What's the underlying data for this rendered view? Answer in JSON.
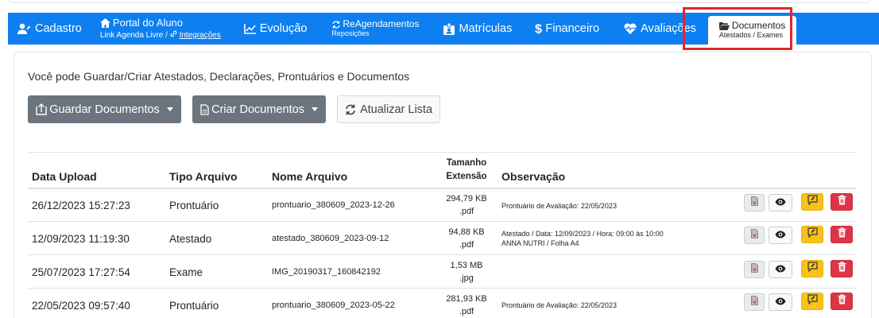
{
  "nav": {
    "cadastro": "Cadastro",
    "portal_title": "Portal do Aluno",
    "portal_sub_a": "Link Agenda Livre / ",
    "portal_sub_b": "Integrações",
    "evolucao": "Evolução",
    "reag_title": "ReAgendamentos",
    "reag_sub": "Reposições",
    "matriculas": "Matrículas",
    "financeiro": "Financeiro",
    "avaliacoes": "Avaliações",
    "documentos_title": "Documentos",
    "documentos_sub": "Atestados / Exames"
  },
  "colors": {
    "nav_bg": "#0d7ff0",
    "highlight": "#e3262a",
    "btn_dark": "#6c757d",
    "btn_yellow": "#f7c21b",
    "btn_red": "#dc3545"
  },
  "main": {
    "info_text": "Você pode Guardar/Criar Atestados, Declarações, Prontuários e Documentos",
    "guardar_label": "Guardar Documentos",
    "criar_label": "Criar Documentos",
    "atualizar_label": "Atualizar Lista"
  },
  "table": {
    "headers": {
      "data_upload": "Data Upload",
      "tipo_arquivo": "Tipo Arquivo",
      "nome_arquivo": "Nome Arquivo",
      "tamanho": "Tamanho",
      "extensao": "Extensão",
      "observacao": "Observação"
    },
    "rows": [
      {
        "data": "26/12/2023 15:27:23",
        "tipo": "Prontuário",
        "nome": "prontuario_380609_2023-12-26",
        "tamanho": "294,79 KB",
        "ext": ".pdf",
        "obs1": "Prontuário de Avaliação: 22/05/2023",
        "obs2": ""
      },
      {
        "data": "12/09/2023 11:19:30",
        "tipo": "Atestado",
        "nome": "atestado_380609_2023-09-12",
        "tamanho": "94,88 KB",
        "ext": ".pdf",
        "obs1": "Atestado / Data: 12/09/2023 / Hora: 09:00 às 10:00",
        "obs2": "ANNA NUTRI / Folha A4"
      },
      {
        "data": "25/07/2023 17:27:54",
        "tipo": "Exame",
        "nome": "IMG_20190317_160842192",
        "tamanho": "1,53 MB",
        "ext": ".jpg",
        "obs1": "",
        "obs2": ""
      },
      {
        "data": "22/05/2023 09:57:40",
        "tipo": "Prontuário",
        "nome": "prontuario_380609_2023-05-22",
        "tamanho": "281,93 KB",
        "ext": ".pdf",
        "obs1": "Prontuário de Avaliação: 22/05/2023",
        "obs2": ""
      }
    ]
  },
  "icons": [
    "user-icon",
    "home-icon",
    "link-icon",
    "chart-line-icon",
    "sync-icon",
    "id-badge-icon",
    "dollar-icon",
    "heart-pulse-icon",
    "folder-open-icon",
    "file-upload-icon",
    "file-icon",
    "refresh-icon",
    "file-pdf-icon",
    "eye-icon",
    "comment-edit-icon",
    "trash-icon"
  ]
}
